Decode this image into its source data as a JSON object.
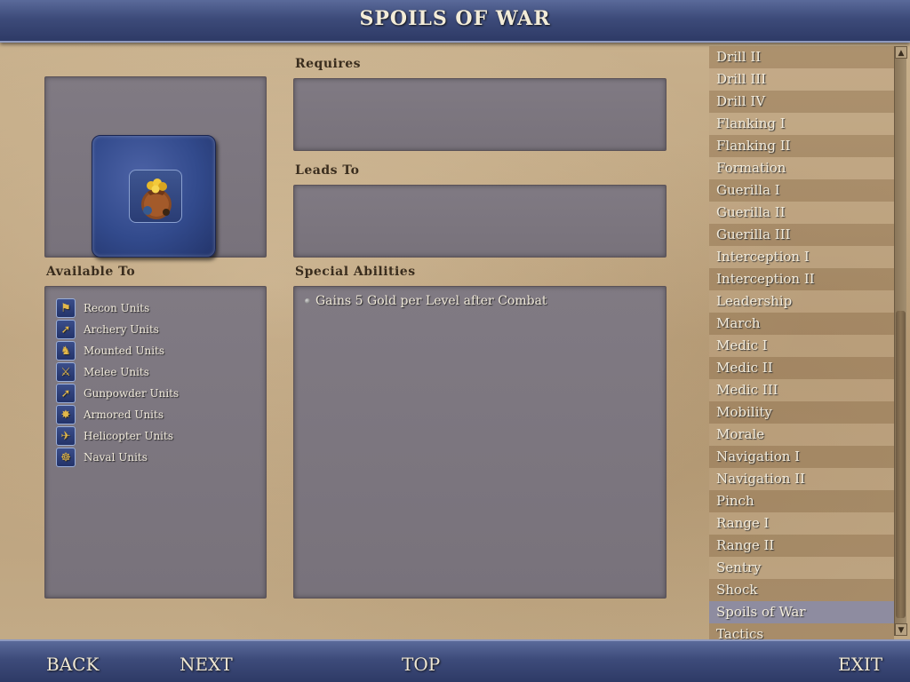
{
  "title": "SPOILS OF WAR",
  "headings": {
    "requires": "Requires",
    "leads_to": "Leads To",
    "available_to": "Available To",
    "special_abilities": "Special Abilities"
  },
  "available_to": [
    {
      "label": "Recon Units",
      "icon": "recon-unit-icon"
    },
    {
      "label": "Archery Units",
      "icon": "archery-unit-icon"
    },
    {
      "label": "Mounted Units",
      "icon": "mounted-unit-icon"
    },
    {
      "label": "Melee Units",
      "icon": "melee-unit-icon"
    },
    {
      "label": "Gunpowder Units",
      "icon": "gunpowder-unit-icon"
    },
    {
      "label": "Armored Units",
      "icon": "armored-unit-icon"
    },
    {
      "label": "Helicopter Units",
      "icon": "helicopter-unit-icon"
    },
    {
      "label": "Naval Units",
      "icon": "naval-unit-icon"
    }
  ],
  "special_abilities": [
    "Gains 5 Gold per Level after Combat"
  ],
  "promotions": [
    "Drill II",
    "Drill III",
    "Drill IV",
    "Flanking I",
    "Flanking II",
    "Formation",
    "Guerilla I",
    "Guerilla II",
    "Guerilla III",
    "Interception I",
    "Interception II",
    "Leadership",
    "March",
    "Medic I",
    "Medic II",
    "Medic III",
    "Mobility",
    "Morale",
    "Navigation I",
    "Navigation II",
    "Pinch",
    "Range I",
    "Range II",
    "Sentry",
    "Shock",
    "Spoils of War",
    "Tactics"
  ],
  "selected_promotion": "Spoils of War",
  "nav": {
    "back": "BACK",
    "next": "NEXT",
    "top": "TOP",
    "exit": "EXIT"
  },
  "colors": {
    "bar": "#3d4b7a",
    "panel": "#7d7780",
    "parchment": "#c2aa86",
    "selected_row": "#8e8ca0"
  }
}
